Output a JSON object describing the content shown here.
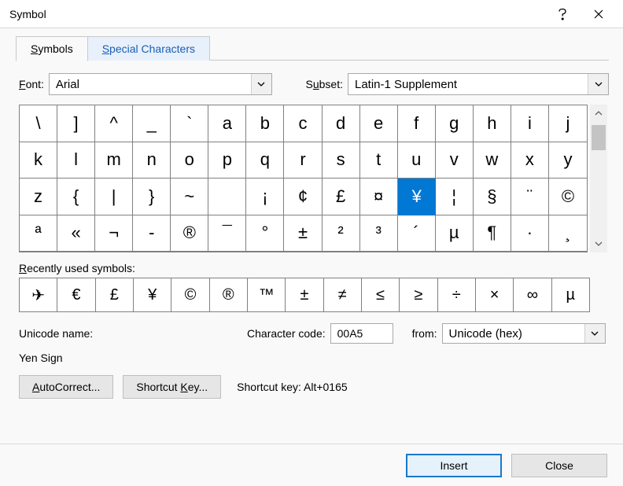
{
  "title": "Symbol",
  "tabs": {
    "symbols": "Symbols",
    "special": "Special Characters"
  },
  "labels": {
    "font": "Font:",
    "subset": "Subset:",
    "recent": "Recently used symbols:",
    "unicode_name": "Unicode name:",
    "char_code": "Character code:",
    "from": "from:",
    "shortcut_key_text": "Shortcut key: Alt+0165"
  },
  "font_combo": {
    "value": "Arial"
  },
  "subset_combo": {
    "value": "Latin-1 Supplement"
  },
  "grid": [
    "\\",
    "]",
    "^",
    "_",
    "`",
    "a",
    "b",
    "c",
    "d",
    "e",
    "f",
    "g",
    "h",
    "i",
    "j",
    "k",
    "l",
    "m",
    "n",
    "o",
    "p",
    "q",
    "r",
    "s",
    "t",
    "u",
    "v",
    "w",
    "x",
    "y",
    "z",
    "{",
    "|",
    "}",
    "~",
    "",
    "¡",
    "¢",
    "£",
    "¤",
    "¥",
    "¦",
    "§",
    "¨",
    "©",
    "ª",
    "«",
    "¬",
    "­-",
    "®",
    "¯",
    "°",
    "±",
    "²",
    "³",
    "´",
    "µ",
    "¶",
    "·",
    "¸"
  ],
  "selected_index": 40,
  "recent": [
    "✈",
    "€",
    "£",
    "¥",
    "©",
    "®",
    "™",
    "±",
    "≠",
    "≤",
    "≥",
    "÷",
    "×",
    "∞",
    "µ"
  ],
  "unicode_name_value": "Yen Sign",
  "char_code_value": "00A5",
  "from_combo": {
    "value": "Unicode (hex)"
  },
  "buttons": {
    "autocorrect": "AutoCorrect...",
    "shortcut": "Shortcut Key...",
    "insert": "Insert",
    "close": "Close"
  }
}
